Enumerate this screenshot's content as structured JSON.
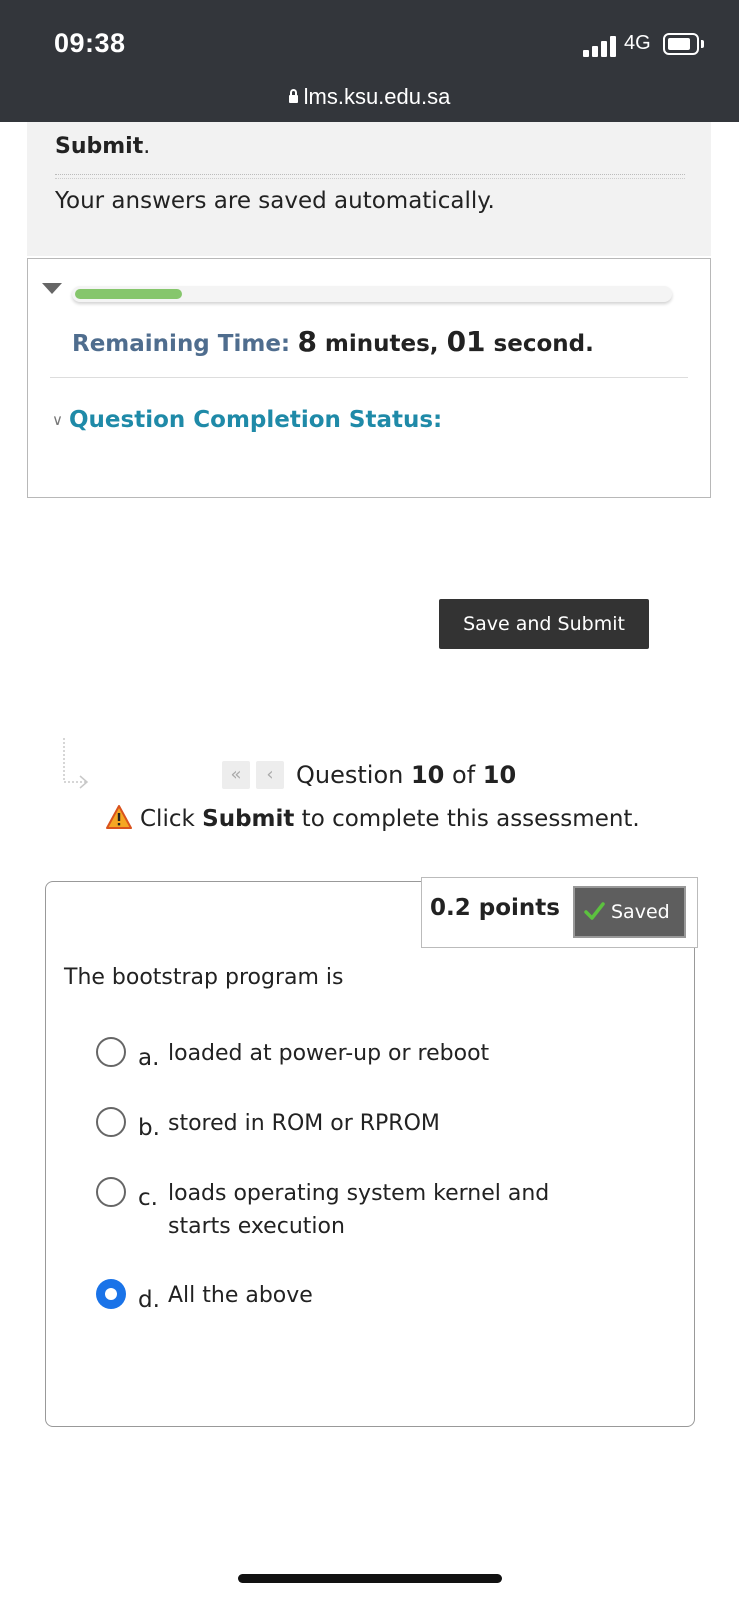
{
  "status_bar": {
    "time": "09:38",
    "network": "4G",
    "url": "lms.ksu.edu.sa",
    "icons": [
      "signal-icon",
      "battery-icon",
      "lock-icon"
    ]
  },
  "instructions": {
    "submit_word": "Submit",
    "submit_period": ".",
    "saved_text": "Your answers are saved automatically."
  },
  "timer": {
    "progress_fraction": 0.18,
    "progress_color": "#86c66c",
    "label": "Remaining Time:",
    "minutes_value": "8",
    "minutes_label": " minutes, ",
    "seconds_value": "01",
    "seconds_label": " second."
  },
  "completion": {
    "label": "Question Completion Status:"
  },
  "save_submit": {
    "label": "Save and Submit"
  },
  "navigation": {
    "first_icon": "double-chevron-left-icon",
    "prev_icon": "chevron-left-icon",
    "prefix": "Question ",
    "current": "10",
    "of": " of ",
    "total": "10"
  },
  "notice": {
    "pre": "Click ",
    "bold": "Submit",
    "post": " to complete this assessment."
  },
  "question": {
    "points": "0.2 points",
    "saved_label": "Saved",
    "text": "The bootstrap program is",
    "selected": "d",
    "options": [
      {
        "letter": "a.",
        "text": "loaded at power-up or reboot"
      },
      {
        "letter": "b.",
        "text": "stored in ROM or RPROM"
      },
      {
        "letter": "c.",
        "text": "loads operating system kernel and starts execution"
      },
      {
        "letter": "d.",
        "text": "All the above"
      }
    ]
  },
  "colors": {
    "status_bar_bg": "#33363b",
    "accent_blue": "#1a73e8",
    "completion_teal": "#1f8aa8",
    "remaining_label": "#4f6d8e"
  }
}
